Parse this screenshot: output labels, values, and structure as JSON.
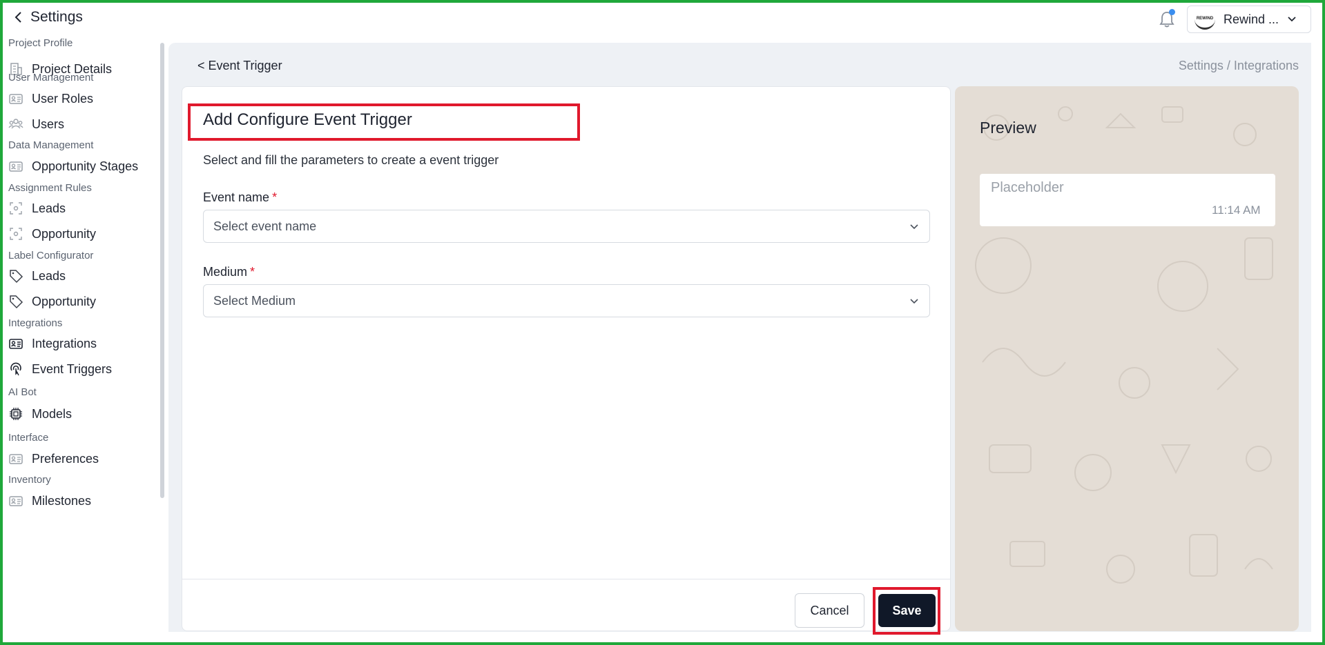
{
  "header": {
    "back_label": "Settings",
    "account_name": "Rewind ...",
    "account_logo_text": "REWIND"
  },
  "sidebar": {
    "sections": [
      {
        "title": "Project Profile",
        "items": [
          {
            "label": "Project Details",
            "icon": "building-icon"
          }
        ]
      },
      {
        "title": "User Management",
        "items": [
          {
            "label": "User Roles",
            "icon": "id-card-icon"
          },
          {
            "label": "Users",
            "icon": "users-icon"
          }
        ]
      },
      {
        "title": "Data Management",
        "items": [
          {
            "label": "Opportunity Stages",
            "icon": "id-card-icon"
          }
        ]
      },
      {
        "title": "Assignment Rules",
        "items": [
          {
            "label": "Leads",
            "icon": "focus-icon"
          },
          {
            "label": "Opportunity",
            "icon": "focus-icon"
          }
        ]
      },
      {
        "title": "Label Configurator",
        "items": [
          {
            "label": "Leads",
            "icon": "tag-icon"
          },
          {
            "label": "Opportunity",
            "icon": "tag-icon"
          }
        ]
      },
      {
        "title": "Integrations",
        "items": [
          {
            "label": "Integrations",
            "icon": "id-card-icon"
          },
          {
            "label": "Event Triggers",
            "icon": "touch-icon"
          }
        ]
      },
      {
        "title": "AI Bot",
        "items": [
          {
            "label": "Models",
            "icon": "chip-icon"
          }
        ]
      },
      {
        "title": "Interface",
        "items": [
          {
            "label": "Preferences",
            "icon": "id-card-icon"
          }
        ]
      },
      {
        "title": "Inventory",
        "items": [
          {
            "label": "Milestones",
            "icon": "id-card-icon"
          }
        ]
      }
    ]
  },
  "breadcrumb": {
    "back": "< Event Trigger",
    "path": "Settings / Integrations"
  },
  "form": {
    "title": "Add Configure Event Trigger",
    "subtitle": "Select and fill the parameters to create a event trigger",
    "event_name_label": "Event name",
    "event_name_placeholder": "Select event name",
    "medium_label": "Medium",
    "medium_placeholder": "Select Medium",
    "required_mark": "*",
    "cancel_label": "Cancel",
    "save_label": "Save"
  },
  "preview": {
    "title": "Preview",
    "message": "Placeholder",
    "time": "11:14 AM"
  },
  "colors": {
    "annotation_red": "#e0192d",
    "frame_green": "#1fa83a",
    "save_bg": "#101828",
    "preview_bg": "#e4ddd5",
    "notification_dot": "#3a8ef0"
  }
}
